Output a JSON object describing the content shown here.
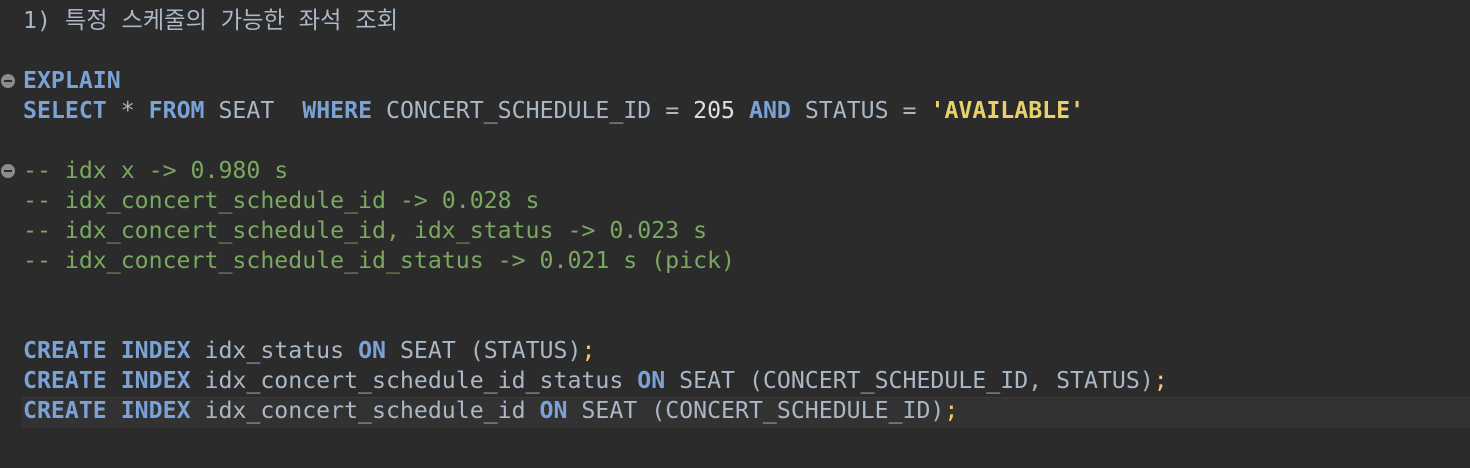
{
  "editor": {
    "heading_note": "1) 특정 스케줄의 가능한 좌석 조회",
    "explain_keyword": "EXPLAIN",
    "select_line": {
      "select_kw": "SELECT",
      "star": " * ",
      "from_kw": "FROM",
      "table": " SEAT  ",
      "where_kw": "WHERE",
      "col1": " CONCERT_SCHEDULE_ID = ",
      "value": "205",
      "and_kw": " AND",
      "col2": " STATUS = ",
      "string_value": "'AVAILABLE'"
    },
    "comments": [
      "-- idx x -> 0.980 s",
      "-- idx_concert_schedule_id -> 0.028 s",
      "-- idx_concert_schedule_id, idx_status -> 0.023 s",
      "-- idx_concert_schedule_id_status -> 0.021 s (pick)"
    ],
    "create_statements": [
      {
        "create_kw": "CREATE",
        "index_kw": " INDEX",
        "name": " idx_status ",
        "on_kw": "ON",
        "target": " SEAT (STATUS)",
        "semi": ";"
      },
      {
        "create_kw": "CREATE",
        "index_kw": " INDEX",
        "name": " idx_concert_schedule_id_status ",
        "on_kw": "ON",
        "target": " SEAT (CONCERT_SCHEDULE_ID, STATUS)",
        "semi": ";"
      },
      {
        "create_kw": "CREATE",
        "index_kw": " INDEX",
        "name": " idx_concert_schedule_id ",
        "on_kw": "ON",
        "target": " SEAT (CONCERT_SCHEDULE_ID)",
        "semi": ";"
      }
    ],
    "colors": {
      "background": "#2b2b2b",
      "keyword": "#7aa2d6",
      "identifier": "#a9b7c6",
      "comment": "#79a861",
      "string": "#e8d06a",
      "semicolon": "#ffc66d",
      "current_line": "#323232"
    },
    "icons": [
      "fold-collapse-icon",
      "fold-collapse-icon"
    ]
  }
}
